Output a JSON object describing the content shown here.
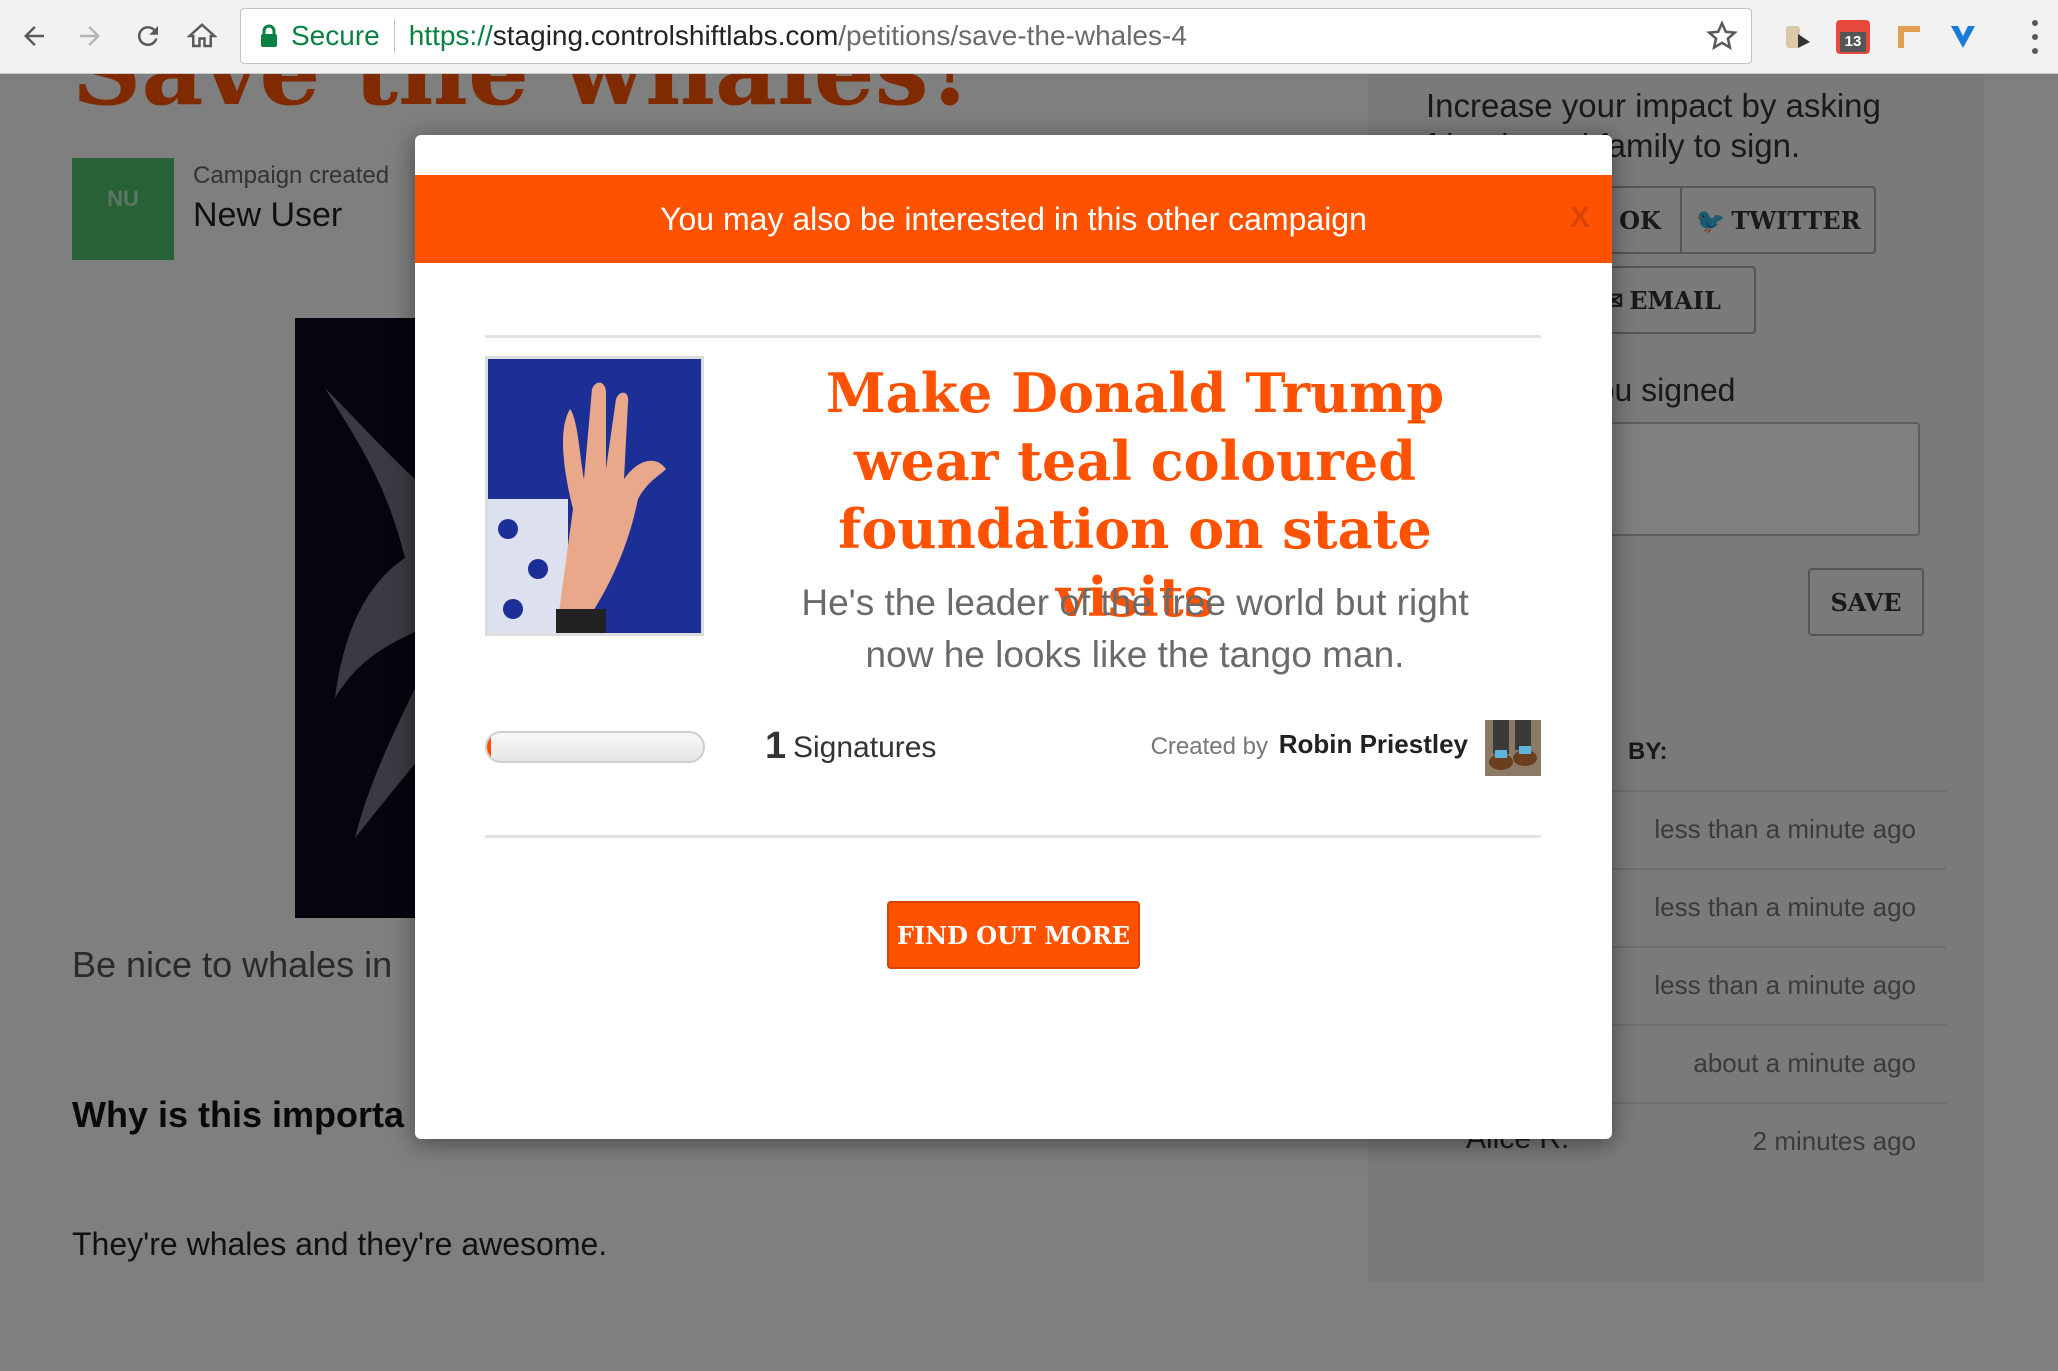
{
  "browser": {
    "secure_label": "Secure",
    "url_scheme": "https://",
    "url_host": "staging.controlshiftlabs.com",
    "url_path": "/petitions/save-the-whales-4",
    "calendar_badge": "13"
  },
  "page": {
    "title": "Save the whales!",
    "avatar_initials": "NU",
    "created_label": "Campaign created",
    "creator_name": "New User",
    "description": "Be nice to whales in",
    "why_heading": "Why is this importa",
    "why_body": "They're whales and they're awesome."
  },
  "sidebar": {
    "share_text": "Increase your impact by asking friends and family to sign.",
    "facebook_label": "OK",
    "twitter_label": "TWITTER",
    "email_label": "EMAIL",
    "comment_label": "hy you signed",
    "save_label": "SAVE",
    "signed_by_label": "BY:",
    "signers": [
      {
        "name": "",
        "time": "less than a minute ago"
      },
      {
        "name": "",
        "time": "less than a minute ago"
      },
      {
        "name": "",
        "time": "less than a minute ago"
      },
      {
        "name": "",
        "time": "about a minute ago"
      },
      {
        "name": "Alice R.",
        "time": "2 minutes ago"
      }
    ]
  },
  "modal": {
    "header": "You may also be interested in this other campaign",
    "close_label": "X",
    "campaign_title": "Make Donald Trump wear teal coloured foundation on state visits",
    "campaign_summary": "He's the leader of the free world but right now he looks like the tango man.",
    "signature_count": "1",
    "signature_label": "Signatures",
    "progress_fraction": 0.02,
    "created_by_label": "Created by",
    "creator_name": "Robin Priestley",
    "cta_label": "FIND OUT MORE"
  },
  "colors": {
    "accent": "#ff5200",
    "secure_green": "#0b8043"
  }
}
